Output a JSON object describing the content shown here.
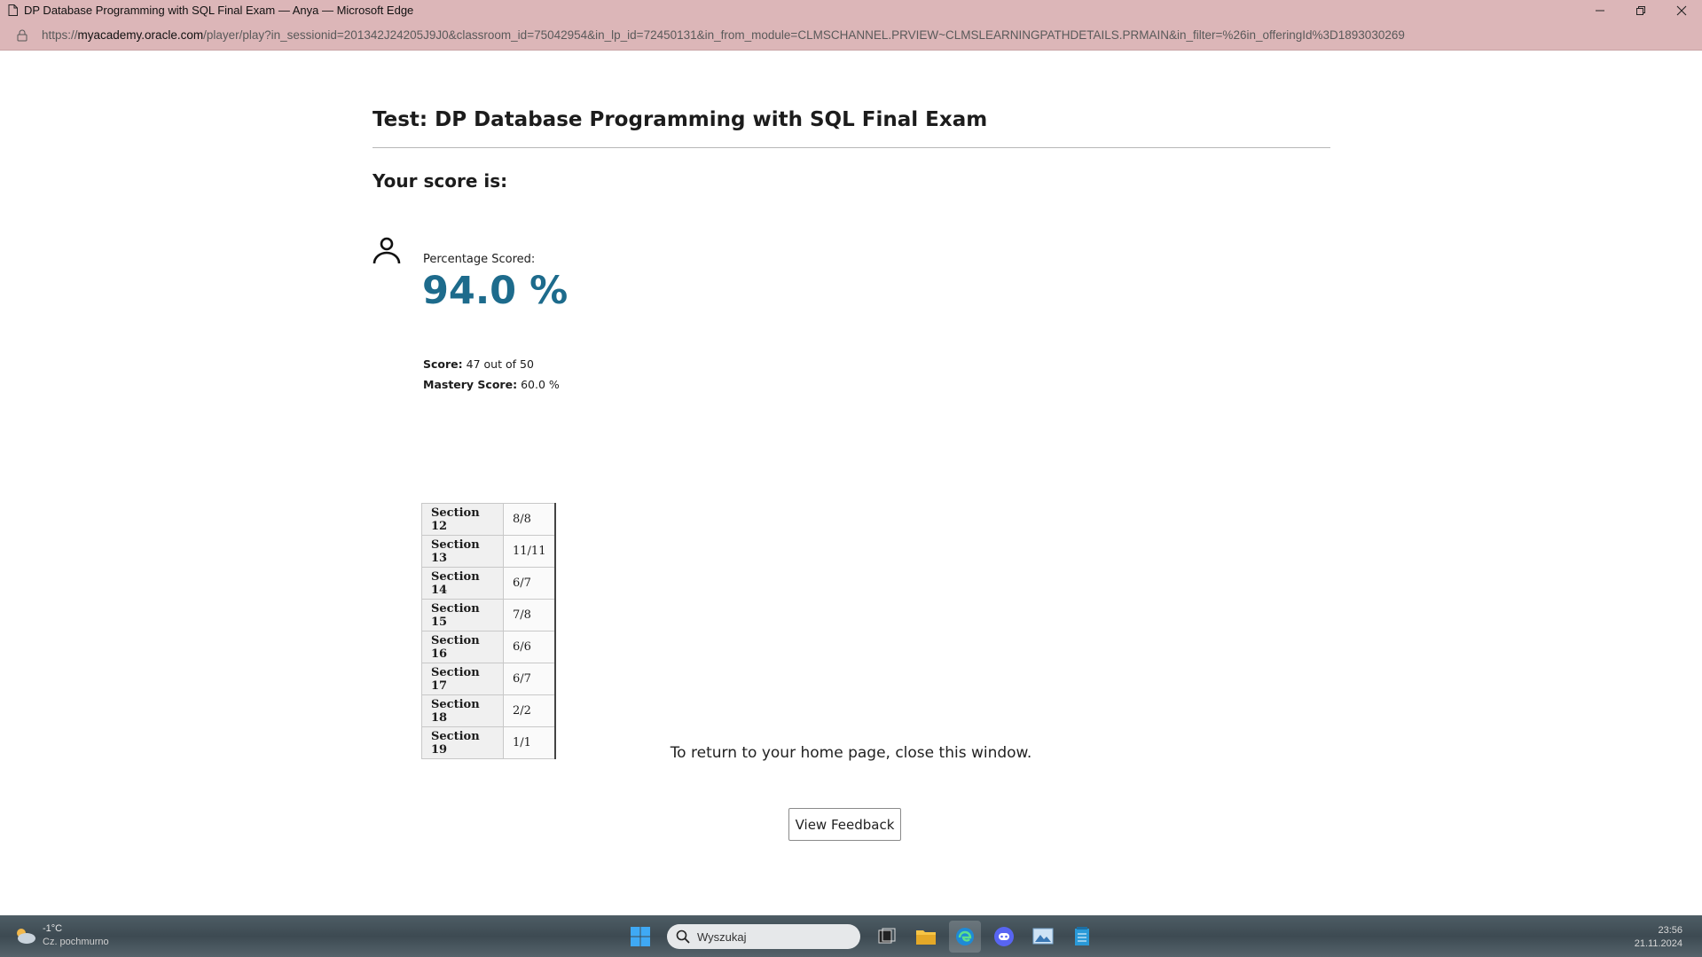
{
  "browser": {
    "window_title": "DP Database Programming with SQL Final Exam — Anya — Microsoft Edge",
    "url_prefix": "https://",
    "url_host": "myacademy.oracle.com",
    "url_path": "/player/play?in_sessionid=201342J24205J9J0&classroom_id=75042954&in_lp_id=72450131&in_from_module=CLMSCHANNEL.PRVIEW~CLMSLEARNINGPATHDETAILS.PRMAIN&in_filter=%26in_offeringId%3D1893030269"
  },
  "page": {
    "heading": "Test: DP Database Programming with SQL Final Exam",
    "score_label": "Your score is:",
    "percentage_label": "Percentage Scored:",
    "percentage_value": "94.0 %",
    "score_key": "Score:",
    "score_value": "47 out of 50",
    "mastery_key": "Mastery Score:",
    "mastery_value": "60.0 %",
    "sections": [
      {
        "name": "Section 12",
        "result": "8/8"
      },
      {
        "name": "Section 13",
        "result": "11/11"
      },
      {
        "name": "Section 14",
        "result": "6/7"
      },
      {
        "name": "Section 15",
        "result": "7/8"
      },
      {
        "name": "Section 16",
        "result": "6/6"
      },
      {
        "name": "Section 17",
        "result": "6/7"
      },
      {
        "name": "Section 18",
        "result": "2/2"
      },
      {
        "name": "Section 19",
        "result": "1/1"
      }
    ],
    "return_text": "To return to your home page, close this window.",
    "feedback_button": "View Feedback"
  },
  "taskbar": {
    "weather_temp": "-1°C",
    "weather_condition": "Cz. pochmurno",
    "search_placeholder": "Wyszukaj",
    "time": "23:56",
    "date": "21.11.2024"
  },
  "colors": {
    "titlebar_bg": "#dcb6b8",
    "score_accent": "#1d6b8c"
  }
}
